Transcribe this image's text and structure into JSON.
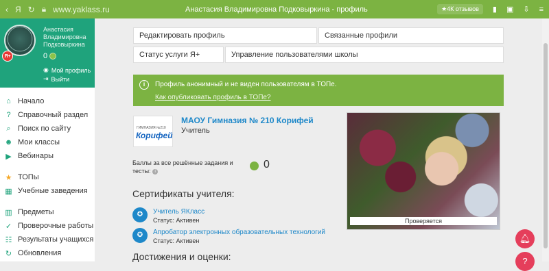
{
  "browser": {
    "url": "www.yaklass.ru",
    "title": "Анастасия Владимировна Подковыркина - профиль",
    "reviews": "★4К отзывов"
  },
  "profile": {
    "name": "Анастасия Владимировна Подковыркина",
    "badge": "Я+",
    "points": "0",
    "my_profile": "Мой профиль",
    "logout": "Выйти"
  },
  "menu": [
    {
      "label": "Начало",
      "icon": "home-icon"
    },
    {
      "label": "Справочный раздел",
      "icon": "help-icon"
    },
    {
      "label": "Поиск по сайту",
      "icon": "search-icon"
    },
    {
      "label": "Мои классы",
      "icon": "users-icon"
    },
    {
      "label": "Вебинары",
      "icon": "play-icon"
    },
    {
      "label": "ТОПы",
      "icon": "star-icon"
    },
    {
      "label": "Учебные заведения",
      "icon": "school-icon"
    },
    {
      "label": "Предметы",
      "icon": "books-icon"
    },
    {
      "label": "Проверочные работы",
      "icon": "check-icon"
    },
    {
      "label": "Результаты учащихся",
      "icon": "results-icon"
    },
    {
      "label": "Обновления",
      "icon": "refresh-icon"
    }
  ],
  "tabs": {
    "edit_profile": "Редактировать профиль",
    "linked_profiles": "Связанные профили",
    "service_status": "Статус услуги Я+",
    "manage_users": "Управление пользователями школы"
  },
  "banner": {
    "text": "Профиль анонимный и не виден пользователям в ТОПе.",
    "link": "Как опубликовать профиль в ТОПе?"
  },
  "school": {
    "logo_small": "ГИМНАЗИЯ №210",
    "logo_big": "Корифей",
    "name": "МАОУ Гимназия № 210 Корифей",
    "role": "Учитель"
  },
  "score": {
    "label": "Баллы за все решённые задания и тесты:",
    "value": "0"
  },
  "certificates": {
    "heading": "Сертификаты учителя:",
    "items": [
      {
        "name": "Учитель ЯКласс",
        "status": "Статус: Активен"
      },
      {
        "name": "Апробатор электронных образовательных технологий",
        "status": "Статус: Активен"
      }
    ]
  },
  "achievements_heading": "Достижения и оценки:",
  "photo_status": "Проверяется",
  "colors": {
    "browser_bar": "#7cb342",
    "profile_bg": "#1fa37c",
    "banner": "#7cb342",
    "link": "#1e88c9",
    "fab": "#e53e5b"
  }
}
